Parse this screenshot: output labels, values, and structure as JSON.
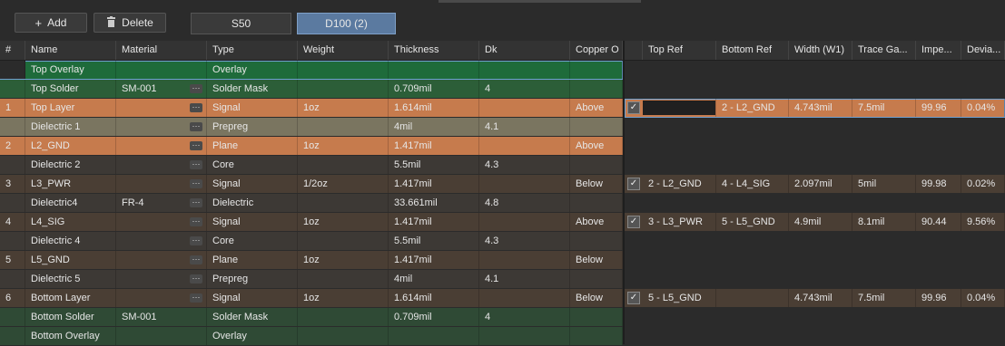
{
  "toolbar": {
    "add_label": "Add",
    "delete_label": "Delete",
    "tabs": [
      "S50",
      "D100 (2)"
    ]
  },
  "layer_table": {
    "columns": [
      "#",
      "Name",
      "Material",
      "Type",
      "Weight",
      "Thickness",
      "Dk",
      "Copper O"
    ],
    "rows": [
      {
        "num": "",
        "name": "Top Overlay",
        "material": "",
        "type": "Overlay",
        "weight": "",
        "thickness": "",
        "dk": "",
        "copper": ""
      },
      {
        "num": "",
        "name": "Top Solder",
        "material": "SM-001",
        "type": "Solder Mask",
        "weight": "",
        "thickness": "0.709mil",
        "dk": "4",
        "copper": ""
      },
      {
        "num": "1",
        "name": "Top Layer",
        "material": "",
        "type": "Signal",
        "weight": "1oz",
        "thickness": "1.614mil",
        "dk": "",
        "copper": "Above"
      },
      {
        "num": "",
        "name": "Dielectric 1",
        "material": "",
        "type": "Prepreg",
        "weight": "",
        "thickness": "4mil",
        "dk": "4.1",
        "copper": ""
      },
      {
        "num": "2",
        "name": "L2_GND",
        "material": "",
        "type": "Plane",
        "weight": "1oz",
        "thickness": "1.417mil",
        "dk": "",
        "copper": "Above"
      },
      {
        "num": "",
        "name": "Dielectric 2",
        "material": "",
        "type": "Core",
        "weight": "",
        "thickness": "5.5mil",
        "dk": "4.3",
        "copper": ""
      },
      {
        "num": "3",
        "name": "L3_PWR",
        "material": "",
        "type": "Signal",
        "weight": "1/2oz",
        "thickness": "1.417mil",
        "dk": "",
        "copper": "Below"
      },
      {
        "num": "",
        "name": "Dielectric4",
        "material": "FR-4",
        "type": "Dielectric",
        "weight": "",
        "thickness": "33.661mil",
        "dk": "4.8",
        "copper": ""
      },
      {
        "num": "4",
        "name": "L4_SIG",
        "material": "",
        "type": "Signal",
        "weight": "1oz",
        "thickness": "1.417mil",
        "dk": "",
        "copper": "Above"
      },
      {
        "num": "",
        "name": "Dielectric 4",
        "material": "",
        "type": "Core",
        "weight": "",
        "thickness": "5.5mil",
        "dk": "4.3",
        "copper": ""
      },
      {
        "num": "5",
        "name": "L5_GND",
        "material": "",
        "type": "Plane",
        "weight": "1oz",
        "thickness": "1.417mil",
        "dk": "",
        "copper": "Below"
      },
      {
        "num": "",
        "name": "Dielectric 5",
        "material": "",
        "type": "Prepreg",
        "weight": "",
        "thickness": "4mil",
        "dk": "4.1",
        "copper": ""
      },
      {
        "num": "6",
        "name": "Bottom Layer",
        "material": "",
        "type": "Signal",
        "weight": "1oz",
        "thickness": "1.614mil",
        "dk": "",
        "copper": "Below"
      },
      {
        "num": "",
        "name": "Bottom Solder",
        "material": "SM-001",
        "type": "Solder Mask",
        "weight": "",
        "thickness": "0.709mil",
        "dk": "4",
        "copper": ""
      },
      {
        "num": "",
        "name": "Bottom Overlay",
        "material": "",
        "type": "Overlay",
        "weight": "",
        "thickness": "",
        "dk": "",
        "copper": ""
      }
    ]
  },
  "impedance_table": {
    "columns": [
      "Top Ref",
      "Bottom Ref",
      "Width (W1)",
      "Trace Ga...",
      "Impe...",
      "Devia..."
    ],
    "rows": [
      {},
      {},
      {
        "check": "✓",
        "top_ref": "",
        "bottom_ref": "2 - L2_GND",
        "width": "4.743mil",
        "gap": "7.5mil",
        "imp": "99.96",
        "dev": "0.04%"
      },
      {},
      {},
      {},
      {
        "check": "✓",
        "top_ref": "2 - L2_GND",
        "bottom_ref": "4 - L4_SIG",
        "width": "2.097mil",
        "gap": "5mil",
        "imp": "99.98",
        "dev": "0.02%"
      },
      {},
      {
        "check": "✓",
        "top_ref": "3 - L3_PWR",
        "bottom_ref": "5 - L5_GND",
        "width": "4.9mil",
        "gap": "8.1mil",
        "imp": "90.44",
        "dev": "9.56%"
      },
      {},
      {},
      {},
      {
        "check": "✓",
        "top_ref": "5 - L5_GND",
        "bottom_ref": "",
        "width": "4.743mil",
        "gap": "7.5mil",
        "imp": "99.96",
        "dev": "0.04%"
      },
      {},
      {}
    ]
  },
  "colors": {
    "overlay": "#1e6b3a",
    "solder_mask": "#2c5e38",
    "signal_top": "#c67b4d",
    "dielectric_light": "#7a7560",
    "layer_dark": "#4a3e34",
    "selected_tab": "#5b7aa0"
  }
}
